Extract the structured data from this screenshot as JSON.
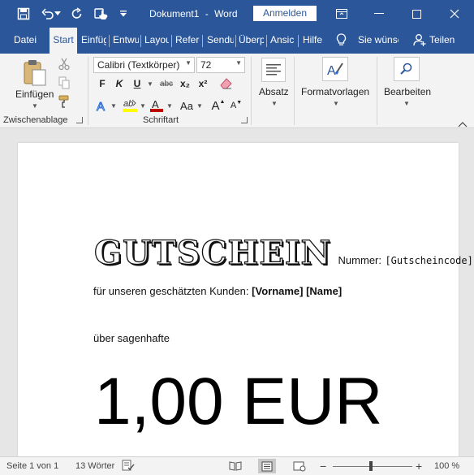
{
  "app": {
    "document_title": "Dokument1",
    "separator": "-",
    "app_name": "Word",
    "signin_label": "Anmelden"
  },
  "tabs": [
    {
      "label": "Datei"
    },
    {
      "label": "Start"
    },
    {
      "label": "Einfüg"
    },
    {
      "label": "Entwu"
    },
    {
      "label": "Layou"
    },
    {
      "label": "Refere"
    },
    {
      "label": "Sendu"
    },
    {
      "label": "Überp"
    },
    {
      "label": "Ansic"
    },
    {
      "label": "Hilfe"
    }
  ],
  "tellme": {
    "label": "Sie wünsc"
  },
  "share": {
    "label": "Teilen"
  },
  "ribbon": {
    "clipboard": {
      "paste_label": "Einfügen",
      "group_label": "Zwischenablage"
    },
    "font": {
      "font_name": "Calibri (Textkörper)",
      "font_size": "72",
      "bold": "F",
      "italic": "K",
      "underline": "U",
      "strikethrough": "abc",
      "subscript": "x₂",
      "superscript": "x²",
      "case": "Aa",
      "grow": "A",
      "shrink": "A",
      "group_label": "Schriftart"
    },
    "paragraph": {
      "label": "Absatz"
    },
    "styles": {
      "label": "Formatvorlagen"
    },
    "editing": {
      "label": "Bearbeiten"
    }
  },
  "colors": {
    "brand": "#2b579a",
    "highlight": "#ffff00",
    "font_color": "#c00000",
    "text_effects": "#2b6cd6"
  },
  "document": {
    "heading": "GUTSCHEIN",
    "number_label": "Nummer:",
    "code": "[Gutscheincode]",
    "customer_prefix": "für unseren geschätzten Kunden:",
    "customer_fields": "[Vorname] [Name]",
    "amount_prefix": "über sagenhafte",
    "amount": "1,00 EUR"
  },
  "status": {
    "page": "Seite 1 von 1",
    "words": "13 Wörter",
    "zoom": "100 %",
    "zoom_minus": "−",
    "zoom_plus": "+"
  }
}
